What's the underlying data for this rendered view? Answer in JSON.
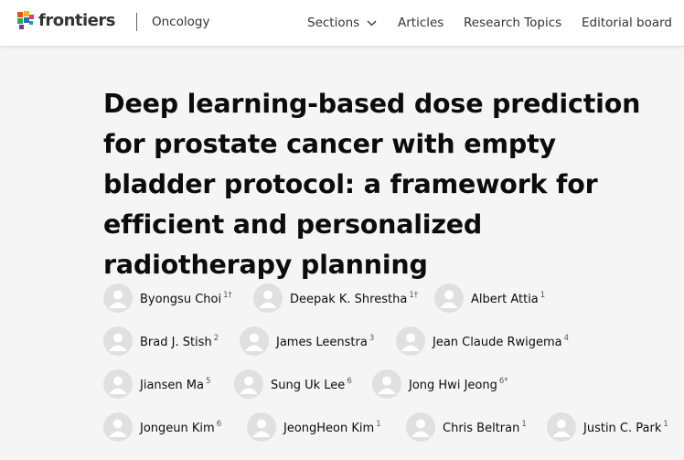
{
  "header": {
    "logo_text": "frontiers",
    "journal": "Oncology",
    "nav": {
      "sections": "Sections",
      "articles": "Articles",
      "research_topics": "Research Topics",
      "editorial_board": "Editorial board"
    }
  },
  "article": {
    "title": "Deep learning-based dose prediction for prostate cancer with empty bladder protocol: a framework for efficient and personalized radiotherapy planning"
  },
  "authors": [
    {
      "name": "Byongsu Choi",
      "aff": "1†"
    },
    {
      "name": "Deepak K. Shrestha",
      "aff": "1†"
    },
    {
      "name": "Albert Attia",
      "aff": "1"
    },
    {
      "name": "Brad J. Stish",
      "aff": "2"
    },
    {
      "name": "James Leenstra",
      "aff": "3"
    },
    {
      "name": "Jean Claude Rwigema",
      "aff": "4"
    },
    {
      "name": "Jiansen Ma",
      "aff": "5"
    },
    {
      "name": "Sung Uk Lee",
      "aff": "6"
    },
    {
      "name": "Jong Hwi Jeong",
      "aff": "6*"
    },
    {
      "name": "Jongeun Kim",
      "aff": "6"
    },
    {
      "name": "JeongHeon Kim",
      "aff": "1"
    },
    {
      "name": "Chris Beltran",
      "aff": "1"
    },
    {
      "name": "Justin C. Park",
      "aff": "1"
    }
  ]
}
